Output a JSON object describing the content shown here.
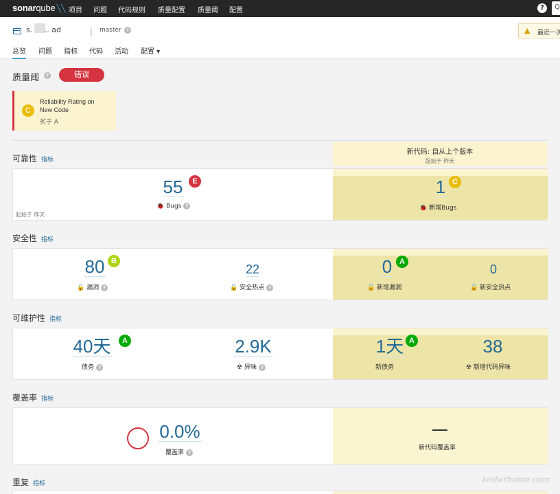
{
  "topnav": {
    "logo_bold": "sonar",
    "logo_light": "qube",
    "items": [
      "项目",
      "问题",
      "代码规则",
      "质量配置",
      "质量阈",
      "配置"
    ],
    "help": "?",
    "search_glyph": "Q"
  },
  "project": {
    "name": "s.  ... .. ad",
    "branch": "master",
    "warning": "最近一次",
    "tabs": [
      "总览",
      "问题",
      "指标",
      "代码",
      "活动",
      "配置 ▾"
    ]
  },
  "quality_gate": {
    "title": "质量阈",
    "status": "错误",
    "status_color": "#d4333f",
    "condition": {
      "rating": "C",
      "text": "Reliability Rating on New Code",
      "detail": "劣于 A"
    }
  },
  "new_code": {
    "title": "新代码: 自从上个版本",
    "since": "起始于 昨天"
  },
  "metrics_link": "指标",
  "reliability": {
    "title": "可靠性",
    "since": "起始于 昨天",
    "bugs": "55",
    "bugs_rating": "E",
    "bugs_label": "Bugs",
    "new_bugs": "1",
    "new_bugs_rating": "C",
    "new_bugs_label": "新增Bugs"
  },
  "security": {
    "title": "安全性",
    "vulns": "80",
    "vulns_rating": "B",
    "vulns_label": "漏洞",
    "hotspots": "22",
    "hotspots_label": "安全热点",
    "new_vulns": "0",
    "new_vulns_rating": "A",
    "new_vulns_label": "新增漏洞",
    "new_hotspots": "0",
    "new_hotspots_label": "新安全热点"
  },
  "maintainability": {
    "title": "可维护性",
    "debt": "40天",
    "debt_rating": "A",
    "debt_label": "债务",
    "smells": "2.9K",
    "smells_label": "异味",
    "new_debt": "1天",
    "new_debt_rating": "A",
    "new_debt_label": "新债务",
    "new_smells": "38",
    "new_smells_label": "新增代码异味"
  },
  "coverage": {
    "title": "覆盖率",
    "value": "0.0%",
    "label": "覆盖率",
    "new_label": "新代码覆盖率"
  },
  "duplications": {
    "title": "重复"
  },
  "watermark": "testerhome.com"
}
